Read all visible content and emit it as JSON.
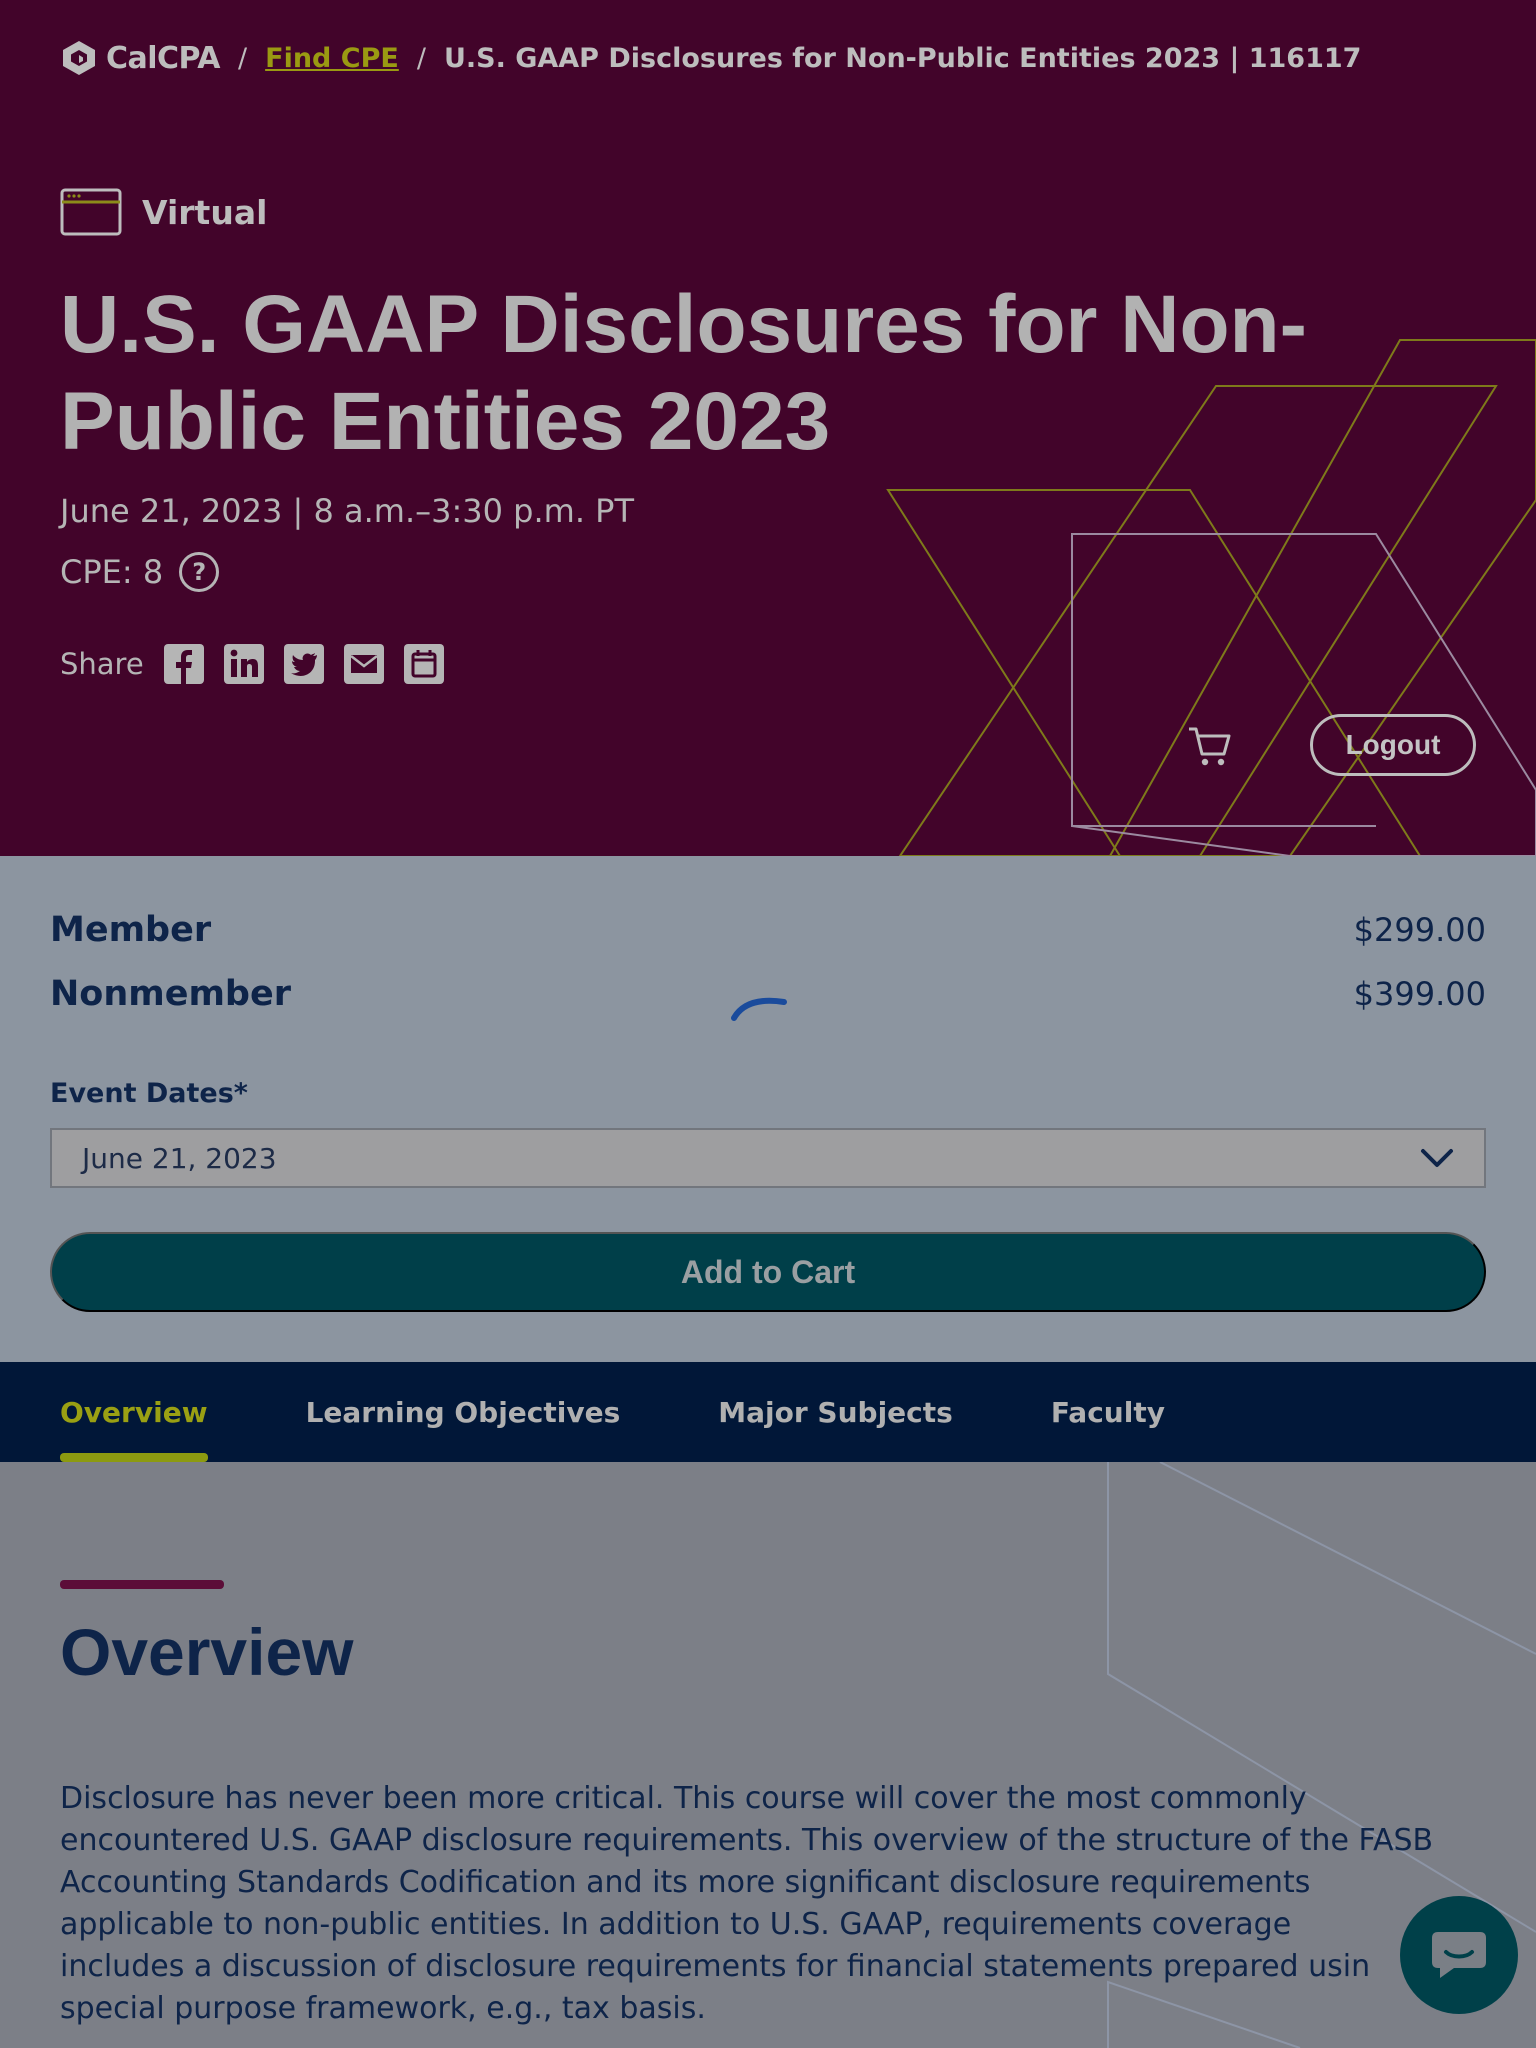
{
  "breadcrumb": {
    "brand": "CalCPA",
    "separator": "/",
    "link": "Find CPE",
    "current": "U.S. GAAP Disclosures for Non-Public Entities 2023 | 116117"
  },
  "event": {
    "format": "Virtual",
    "title_line1": "U.S. GAAP Disclosures for Non-",
    "title_line2": "Public Entities 2023",
    "date_time": "June 21, 2023 | 8 a.m.–3:30 p.m. PT",
    "cpe": "CPE: 8",
    "share_label": "Share",
    "share_icons": [
      "facebook-icon",
      "linkedin-icon",
      "twitter-icon",
      "email-icon",
      "calendar-icon"
    ]
  },
  "header_actions": {
    "cart_icon": "cart-icon",
    "logout_label": "Logout"
  },
  "pricing": [
    {
      "label": "Member",
      "price": "$299.00"
    },
    {
      "label": "Nonmember",
      "price": "$399.00"
    }
  ],
  "purchase": {
    "dates_label": "Event Dates*",
    "selected_date": "June 21, 2023",
    "add_to_cart_label": "Add to Cart"
  },
  "tabs": [
    {
      "label": "Overview",
      "active": true
    },
    {
      "label": "Learning Objectives",
      "active": false
    },
    {
      "label": "Major Subjects",
      "active": false
    },
    {
      "label": "Faculty",
      "active": false
    }
  ],
  "overview": {
    "heading": "Overview",
    "body_lines": [
      "Disclosure has never been more critical. This course will cover the most commonly",
      "encountered U.S. GAAP disclosure requirements. This overview of the structure of the FASB",
      "Accounting Standards Codification and its more significant disclosure requirements",
      "applicable to non-public entities. In addition to U.S. GAAP, requirements coverage",
      "includes a discussion of disclosure requirements for financial statements prepared usin",
      "special purpose framework, e.g., tax basis."
    ]
  },
  "colors": {
    "hero_bg": "#42042a",
    "accent_olive": "#9a9a12",
    "navy": "#0e2449",
    "teal": "#003f49"
  }
}
